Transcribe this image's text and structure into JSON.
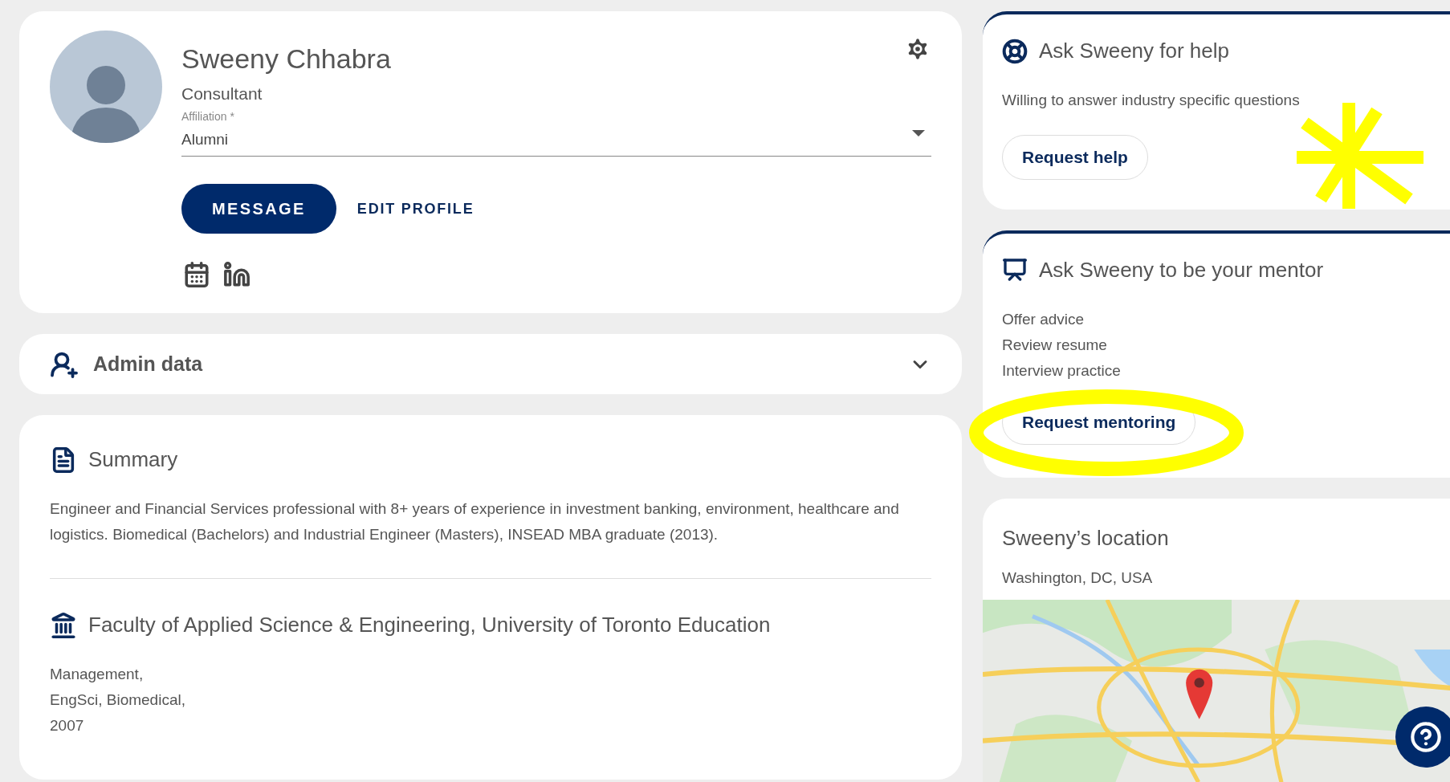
{
  "profile": {
    "name": "Sweeny Chhabra",
    "role": "Consultant",
    "affiliation": {
      "label": "Affiliation *",
      "value": "Alumni"
    },
    "buttons": [
      {
        "label": "MESSAGE",
        "kind": "primary"
      },
      {
        "label": "EDIT PROFILE",
        "kind": "text"
      }
    ]
  },
  "admin": {
    "title": "Admin data",
    "expanded": false
  },
  "summary": {
    "title": "Summary",
    "text": "Engineer and Financial Services professional with 8+ years of experience in investment banking, environment, healthcare and logistics. Biomedical (Bachelors) and Industrial Engineer (Masters), INSEAD MBA graduate (2013)."
  },
  "education": {
    "title": "Faculty of Applied Science & Engineering, University of Toronto Education",
    "lines": [
      "Management,",
      "EngSci, Biomedical,",
      "2007"
    ]
  },
  "help_card": {
    "title": "Ask Sweeny for help",
    "text": "Willing to answer industry specific questions",
    "button": "Request help"
  },
  "mentor_card": {
    "title": "Ask Sweeny to be your mentor",
    "items": [
      "Offer advice",
      "Review resume",
      "Interview practice"
    ],
    "button": "Request mentoring"
  },
  "location_card": {
    "title": "Sweeny’s location",
    "address": "Washington, DC, USA"
  },
  "annotations": [
    {
      "kind": "asterisk"
    },
    {
      "kind": "ellipse"
    }
  ]
}
